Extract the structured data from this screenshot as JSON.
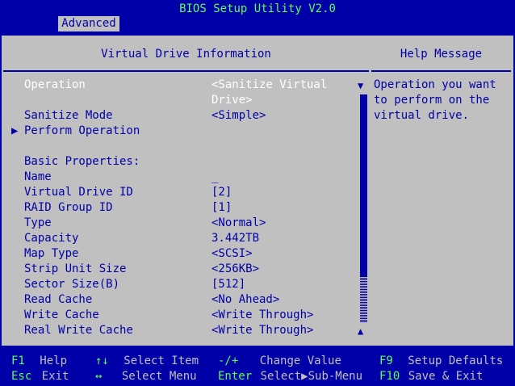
{
  "header": {
    "title": "BIOS Setup Utility V2.0",
    "tab": "Advanced"
  },
  "main": {
    "heading": "Virtual Drive Information",
    "operation": {
      "label": "Operation",
      "value_line1": "<Sanitize Virtual",
      "value_line2": "Drive>"
    },
    "sanitize_mode": {
      "label": "Sanitize Mode",
      "value": "<Simple>"
    },
    "perform_operation": {
      "label": "Perform Operation"
    },
    "section": "Basic Properties:",
    "properties": [
      {
        "label": "Name",
        "value": "_"
      },
      {
        "label": "Virtual Drive ID",
        "value": "[2]"
      },
      {
        "label": "RAID Group ID",
        "value": "[1]"
      },
      {
        "label": "Type",
        "value": "<Normal>"
      },
      {
        "label": "Capacity",
        "value": "3.442TB"
      },
      {
        "label": "Map Type",
        "value": "<SCSI>"
      },
      {
        "label": "Strip Unit Size",
        "value": "<256KB>"
      },
      {
        "label": "Sector Size(B)",
        "value": "[512]"
      },
      {
        "label": "Read Cache",
        "value": "<No Ahead>"
      },
      {
        "label": "Write Cache",
        "value": "<Write Through>"
      },
      {
        "label": "Real Write Cache",
        "value": "<Write Through>"
      }
    ]
  },
  "help": {
    "heading": "Help Message",
    "text": "Operation you want\nto perform on the\nvirtual drive."
  },
  "footer": [
    {
      "key": "F1",
      "text": "Help"
    },
    {
      "key": "Esc",
      "text": "Exit"
    },
    {
      "key": "↑↓",
      "text": "Select Item"
    },
    {
      "key": "↔",
      "text": "Select Menu"
    },
    {
      "key": "-/+",
      "text": "Change Value"
    },
    {
      "key": "Enter",
      "text": "Select▶Sub-Menu"
    },
    {
      "key": "F9",
      "text": "Setup Defaults"
    },
    {
      "key": "F10",
      "text": "Save & Exit"
    }
  ],
  "colors": {
    "background": "#0000a8",
    "panel": "#c0c0c0",
    "key": "#55ff55",
    "selected": "#ffffff"
  }
}
